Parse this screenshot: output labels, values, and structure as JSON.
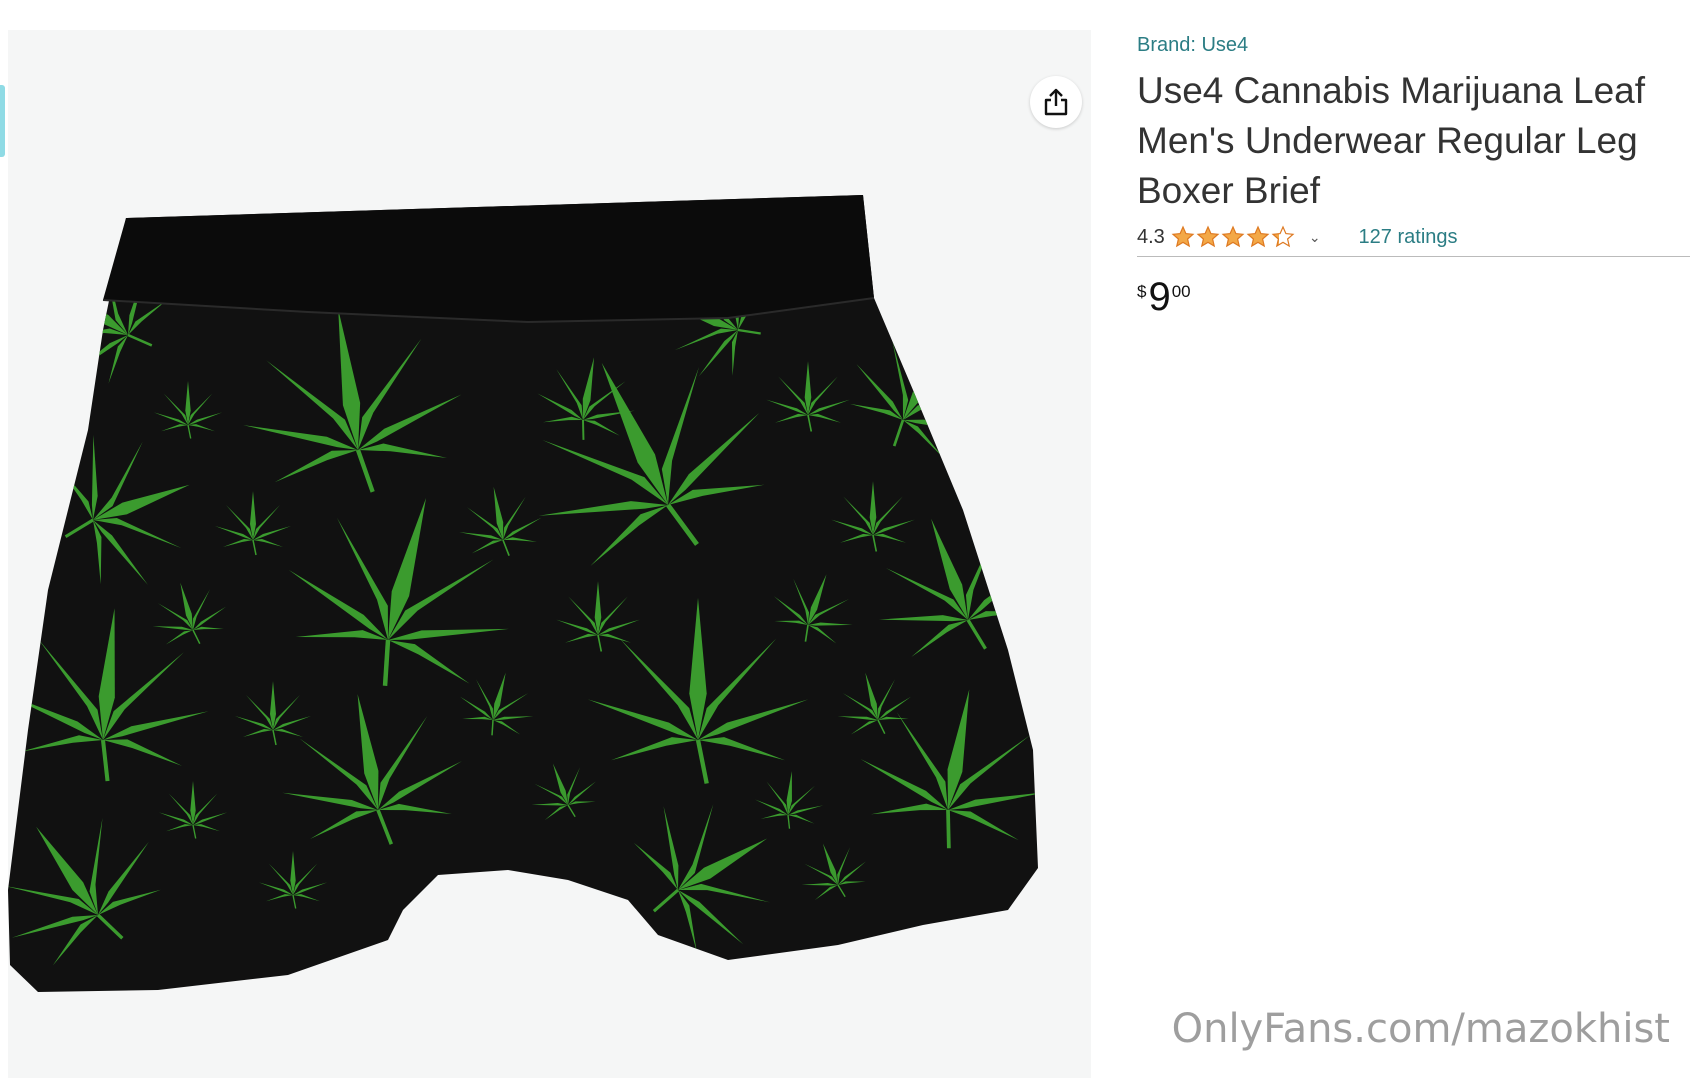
{
  "product": {
    "brand": "Brand: Use4",
    "title": "Use4 Cannabis Marijuana Leaf Men's Underwear Regular Leg Boxer Brief",
    "rating": "4.3",
    "stars_value": 4.3,
    "ratings_count": "127 ratings",
    "price": {
      "symbol": "$",
      "whole": "9",
      "fraction": "00"
    }
  },
  "icons": {
    "share": "share-icon",
    "chevron": "chevron-down-icon",
    "star": "star-icon"
  },
  "colors": {
    "link": "#2b7d84",
    "star": "#f3a847",
    "leaf": "#3b9b2e",
    "fabric": "#111111",
    "image_bg": "#f5f6f6"
  },
  "watermark": "OnlyFans.com/mazokhist"
}
